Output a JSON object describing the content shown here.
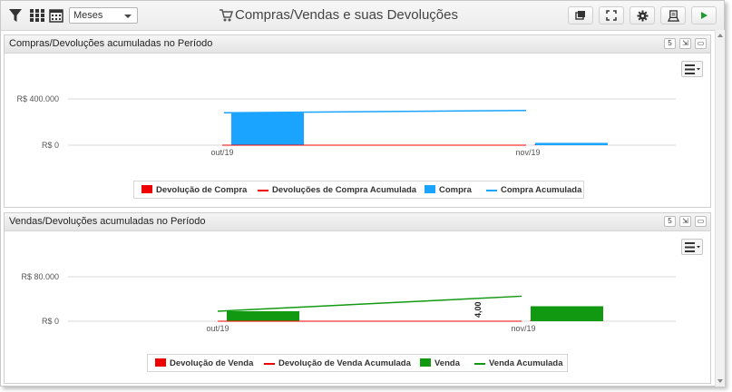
{
  "toolbar": {
    "period_select": "Meses",
    "title": "Compras/Vendas e suas Devoluções",
    "icons": [
      "filter-icon",
      "grid-icon",
      "calendar-icon"
    ],
    "buttons": [
      "window-icon",
      "fullscreen-icon",
      "gear-icon",
      "print-icon",
      "play-icon"
    ]
  },
  "panels": [
    {
      "title": "Compras/Devoluções acumuladas no Período",
      "header_buttons": [
        "5",
        "⇲",
        "▭"
      ]
    },
    {
      "title": "Vendas/Devoluções acumuladas no Período",
      "header_buttons": [
        "5",
        "⇲",
        "▭"
      ]
    }
  ],
  "colors": {
    "devolucao": "#ee0000",
    "compra": "#1aa3ff",
    "venda": "#119911"
  },
  "chart_data": [
    {
      "type": "bar",
      "categories": [
        "out/19",
        "nov/19"
      ],
      "y_ticks": [
        "R$ 0",
        "R$ 400.000"
      ],
      "ylim": [
        0,
        400000
      ],
      "series": [
        {
          "name": "Devolução de Compra",
          "kind": "bar",
          "values": [
            0,
            0
          ]
        },
        {
          "name": "Devoluções de Compra Acumulada",
          "kind": "line",
          "values": [
            0,
            0
          ]
        },
        {
          "name": "Compra",
          "kind": "bar",
          "values": [
            280000,
            20000
          ]
        },
        {
          "name": "Compra Acumulada",
          "kind": "line",
          "values": [
            280000,
            300000
          ]
        }
      ],
      "legend": [
        "Devolução de Compra",
        "Devoluções de Compra Acumulada",
        "Compra",
        "Compra Acumulada"
      ],
      "legend_position": "bottom-center"
    },
    {
      "type": "bar",
      "categories": [
        "out/19",
        "nov/19"
      ],
      "y_ticks": [
        "R$ 0",
        "R$ 80.000"
      ],
      "ylim": [
        0,
        80000
      ],
      "series": [
        {
          "name": "Devolução de Venda",
          "kind": "bar",
          "values": [
            4,
            4
          ]
        },
        {
          "name": "Devolução de Venda Acumulada",
          "kind": "line",
          "values": [
            0,
            0
          ]
        },
        {
          "name": "Venda",
          "kind": "bar",
          "values": [
            18000,
            27000
          ]
        },
        {
          "name": "Venda Acumulada",
          "kind": "line",
          "values": [
            18000,
            45000
          ]
        }
      ],
      "data_labels": [
        "4,00"
      ],
      "legend": [
        "Devolução de Venda",
        "Devolução de Venda Acumulada",
        "Venda",
        "Venda Acumulada"
      ],
      "legend_position": "bottom-center"
    }
  ]
}
